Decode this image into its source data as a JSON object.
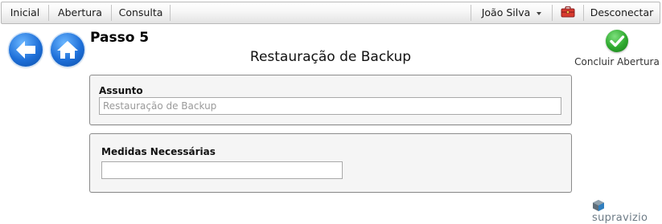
{
  "nav": {
    "items": [
      {
        "label": "Inicial"
      },
      {
        "label": "Abertura"
      },
      {
        "label": "Consulta"
      }
    ],
    "user_name": "João Silva",
    "logout_label": "Desconectar",
    "icons": {
      "user_caret": "chevron-down-icon",
      "toolbox": "toolbox-icon"
    }
  },
  "header": {
    "step": "Passo 5",
    "title": "Restauração de Backup",
    "back_icon": "back-arrow-icon",
    "home_icon": "home-icon",
    "conclude_label": "Concluir Abertura",
    "conclude_icon": "check-circle-icon"
  },
  "form": {
    "subject": {
      "label": "Assunto",
      "placeholder": "Restauração de Backup",
      "value": ""
    },
    "measures": {
      "label": "Medidas Necessárias",
      "value": ""
    }
  },
  "footer": {
    "logo_text": "supravizio"
  },
  "colors": {
    "accent_blue": "#1e6fd8",
    "success_green": "#2da82d",
    "panel_bg": "#f5f5f5"
  }
}
